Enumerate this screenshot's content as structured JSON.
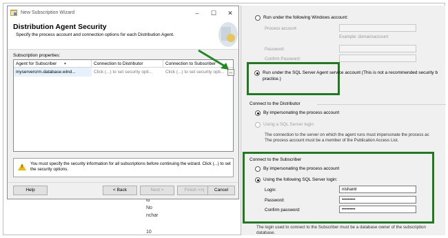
{
  "background": {
    "lines": [
      "ld",
      "No",
      "nchar",
      "10"
    ]
  },
  "wizard": {
    "title": "New Subscription Wizard",
    "header_title": "Distribution Agent Security",
    "header_subtitle": "Specify the process account and connection options for each Distribution Agent.",
    "props_label": "Subscription properties:",
    "columns": [
      "Agent for Subscriber",
      "Connection to Distributor",
      "Connection to Subscriber"
    ],
    "row": {
      "agent": "myservercrm.database.wind...",
      "distributor": "Click (...) to set security opti...",
      "subscriber": "Click (...) to set security opti...",
      "button": "..."
    },
    "warning": "You must specify the security information for all subscriptions before continuing the wizard. Click (...) to set the security options.",
    "buttons": {
      "help": "Help",
      "back": "< Back",
      "next": "Next >",
      "finish": "Finish >>|",
      "cancel": "Cancel"
    }
  },
  "security_dialog": {
    "windows_account_option": "Run under the following Windows account:",
    "process_account_label": "Process account:",
    "process_account_example": "Example: domain\\account",
    "password_label": "Password:",
    "confirm_password_label": "Confirm Password:",
    "agent_service_option": "Run under the SQL Server Agent service account (This is not a recommended security b",
    "agent_service_option_cont": "practice.)",
    "distributor_group": "Connect to the Distributor",
    "dist_impersonate": "By impersonating the process account",
    "dist_sql_login": "Using a SQL Server login",
    "dist_desc_1": "The connection to the server on which the agent runs must impersonate the process ac",
    "dist_desc_2": "The process account must be a member of the Publication Access List.",
    "subscriber_group": "Connect to the Subscriber",
    "sub_impersonate": "By impersonating the process account",
    "sub_sql_login": "Using the following SQL Server login:",
    "login_label": "Login:",
    "login_value": "nishantr",
    "password2_label": "Password:",
    "password2_value": "•••••••••",
    "confirm2_label": "Confirm password:",
    "confirm2_value": "•••••••••",
    "footer_1": "The login used to connect to the Subscriber must be a database owner of the subscription",
    "footer_2": "database."
  },
  "highlight_color": "#1f7a1f"
}
